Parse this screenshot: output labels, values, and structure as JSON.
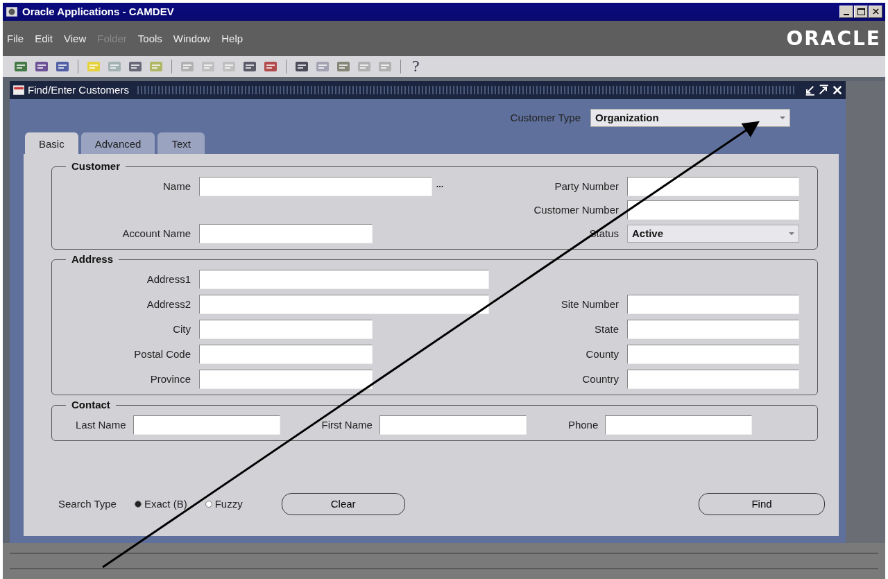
{
  "window": {
    "title": "Oracle Applications - CAMDEV"
  },
  "menu": [
    {
      "label": "File",
      "disabled": false
    },
    {
      "label": "Edit",
      "disabled": false
    },
    {
      "label": "View",
      "disabled": false
    },
    {
      "label": "Folder",
      "disabled": true
    },
    {
      "label": "Tools",
      "disabled": false
    },
    {
      "label": "Window",
      "disabled": false
    },
    {
      "label": "Help",
      "disabled": false
    }
  ],
  "brand": "ORACLE",
  "toolbar": {
    "help_glyph": "?"
  },
  "form": {
    "title": "Find/Enter Customers",
    "customer_type": {
      "label": "Customer Type",
      "value": "Organization"
    },
    "tabs": [
      {
        "label": "Basic",
        "selected": true
      },
      {
        "label": "Advanced",
        "selected": false
      },
      {
        "label": "Text",
        "selected": false
      }
    ],
    "groups": [
      {
        "title": "Customer",
        "rows": [
          {
            "left": {
              "label": "Name",
              "kind": "lov"
            },
            "right": {
              "label": "Party Number",
              "kind": "text"
            }
          },
          {
            "right": {
              "label": "Customer Number",
              "kind": "text"
            }
          },
          {
            "left": {
              "label": "Account Name",
              "kind": "short"
            },
            "right": {
              "label": "Status",
              "kind": "select",
              "value": "Active"
            }
          }
        ]
      },
      {
        "title": "Address",
        "rows": [
          {
            "left": {
              "label": "Address1",
              "kind": "long"
            }
          },
          {
            "left": {
              "label": "Address2",
              "kind": "long"
            },
            "right": {
              "label": "Site Number",
              "kind": "text"
            }
          },
          {
            "left": {
              "label": "City",
              "kind": "short"
            },
            "right": {
              "label": "State",
              "kind": "text"
            }
          },
          {
            "left": {
              "label": "Postal Code",
              "kind": "short"
            },
            "right": {
              "label": "County",
              "kind": "text"
            }
          },
          {
            "left": {
              "label": "Province",
              "kind": "short"
            },
            "right": {
              "label": "Country",
              "kind": "text"
            }
          }
        ]
      }
    ],
    "contact": {
      "title": "Contact",
      "fields": [
        {
          "label": "Last Name"
        },
        {
          "label": "First Name"
        },
        {
          "label": "Phone"
        }
      ]
    },
    "search_type": {
      "label": "Search Type",
      "options": [
        {
          "label": "Exact (B)",
          "selected": true
        },
        {
          "label": "Fuzzy",
          "selected": false
        }
      ]
    },
    "buttons": [
      {
        "label": "Clear",
        "kind": "secondary"
      },
      {
        "label": "Find",
        "kind": "primary"
      }
    ]
  }
}
